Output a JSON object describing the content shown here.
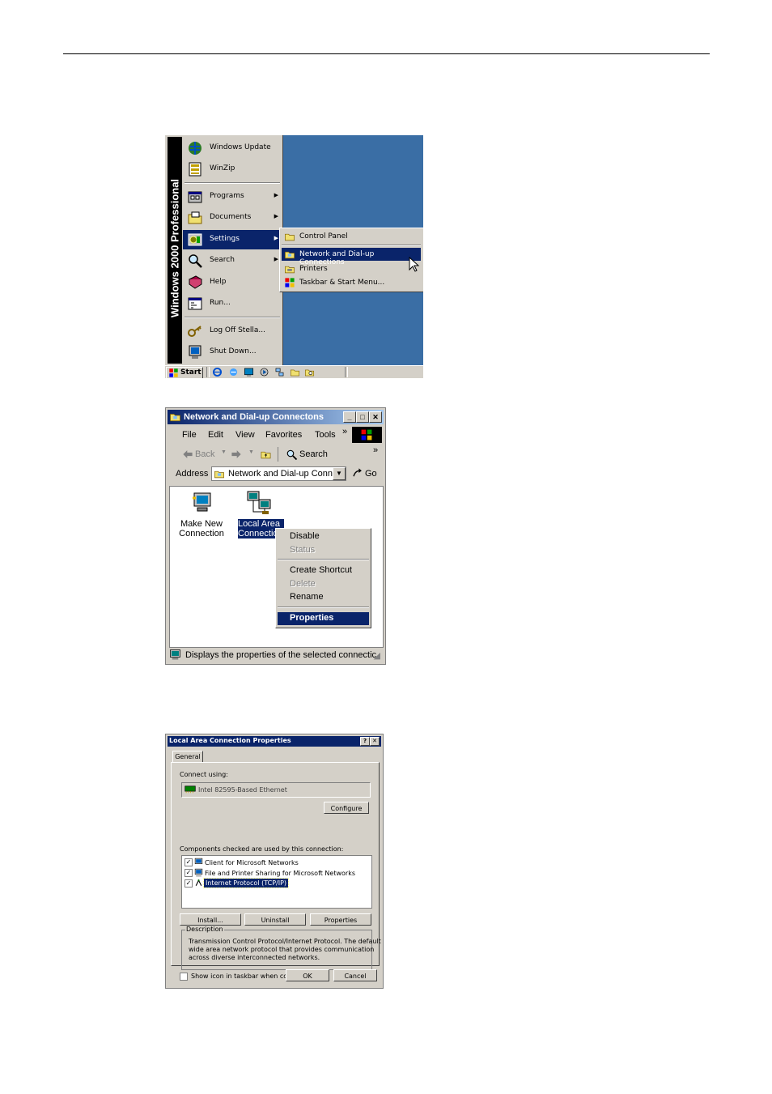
{
  "start_menu": {
    "banner": "Windows 2000 Professional",
    "items": [
      {
        "label": "Windows Update",
        "icon": "windows-update-icon"
      },
      {
        "label": "WinZip",
        "icon": "winzip-icon"
      },
      {
        "label": "Programs",
        "icon": "programs-icon"
      },
      {
        "label": "Documents",
        "icon": "documents-icon"
      },
      {
        "label": "Settings",
        "icon": "settings-icon"
      },
      {
        "label": "Search",
        "icon": "search-icon"
      },
      {
        "label": "Help",
        "icon": "help-icon"
      },
      {
        "label": "Run...",
        "icon": "run-icon"
      },
      {
        "label": "Log Off Stella...",
        "icon": "log-off-icon"
      },
      {
        "label": "Shut Down...",
        "icon": "shut-down-icon"
      }
    ],
    "settings_submenu": [
      {
        "label": "Control Panel"
      },
      {
        "label": "Network and Dial-up Connections"
      },
      {
        "label": "Printers"
      },
      {
        "label": "Taskbar & Start Menu..."
      }
    ],
    "start_button": "Start"
  },
  "explorer": {
    "title": "Network and Dial-up Connectons",
    "menus": [
      "File",
      "Edit",
      "View",
      "Favorites",
      "Tools"
    ],
    "toolbar": {
      "back": "Back",
      "search": "Search"
    },
    "address_label": "Address",
    "address_value": "Network and Dial-up Conn",
    "go": "Go",
    "icons": {
      "make_new_line1": "Make New",
      "make_new_line2": "Connection",
      "lan_line1": "Local Area",
      "lan_line2": "Connectio"
    },
    "context_menu": {
      "disable": "Disable",
      "status": "Status",
      "create_shortcut": "Create Shortcut",
      "delete": "Delete",
      "rename": "Rename",
      "properties": "Properties"
    },
    "status": "Displays the properties of the selected connectic"
  },
  "properties_dialog": {
    "title": "Local Area Connection Properties",
    "tab": "General",
    "connect_using_label": "Connect using:",
    "adapter": "Intel 82595-Based Ethernet",
    "configure": "Configure",
    "components_label": "Components checked are used by this connection:",
    "components": [
      "Client for Microsoft Networks",
      "File and Printer Sharing for Microsoft Networks",
      "Internet Protocol (TCP/IP)"
    ],
    "install": "Install...",
    "uninstall": "Uninstall",
    "properties": "Properties",
    "description_label": "Description",
    "description_lines": [
      "Transmission Control Protocol/Internet Protocol. The default",
      "wide area network protocol that provides communication",
      "across diverse interconnected networks."
    ],
    "show_icon": "Show icon in taskbar when connected",
    "ok": "OK",
    "cancel": "Cancel"
  }
}
